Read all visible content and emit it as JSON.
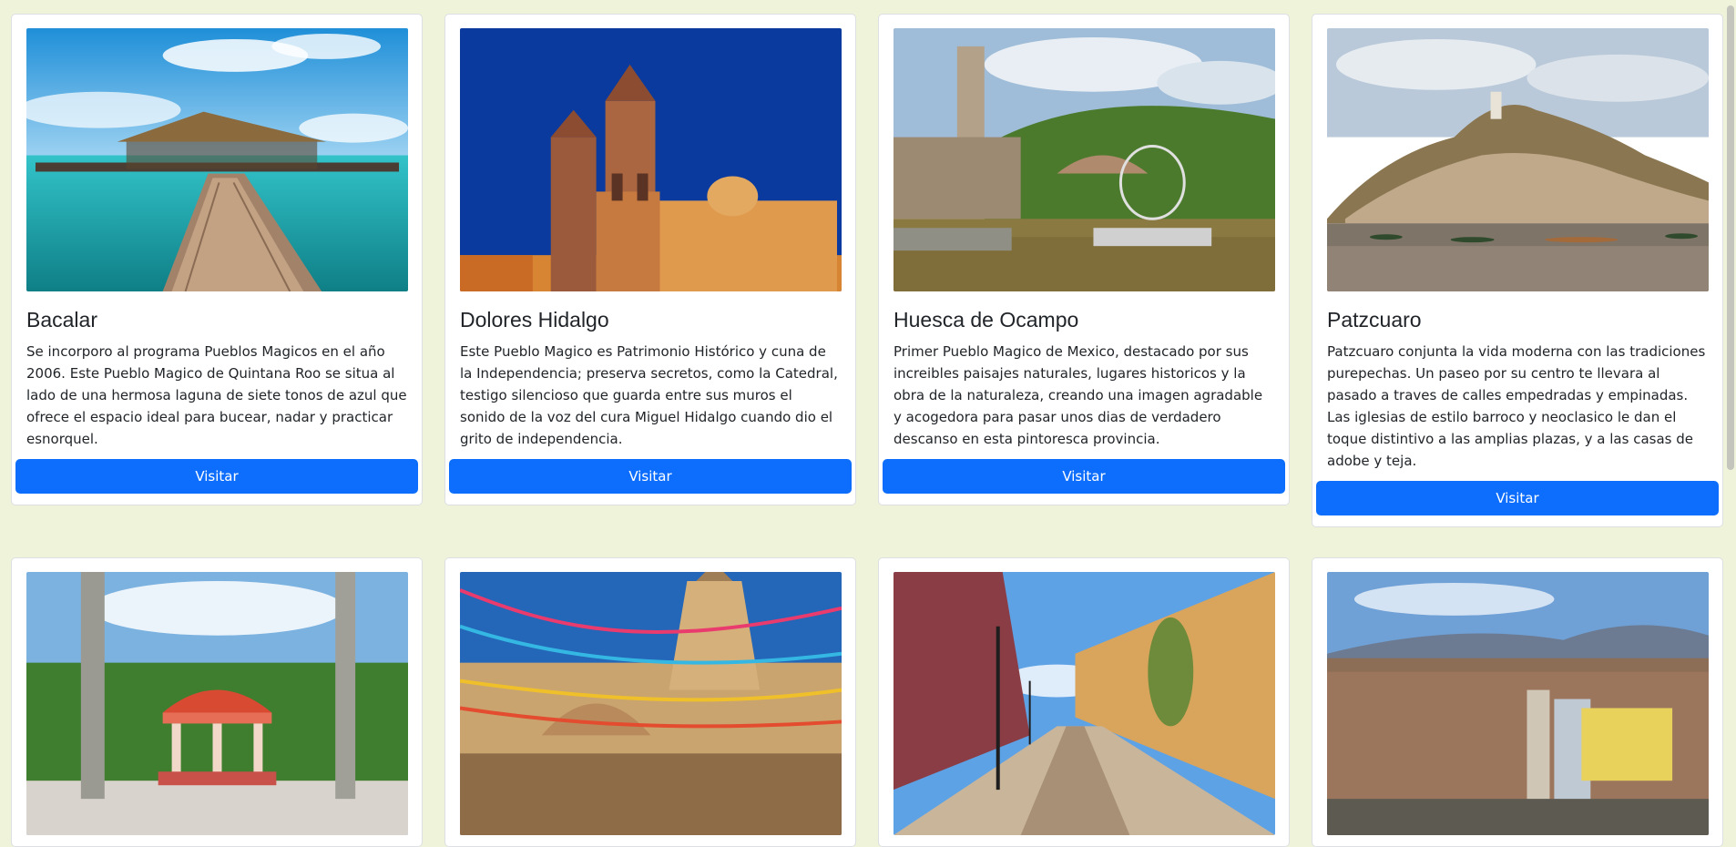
{
  "cards": [
    {
      "title": "Bacalar",
      "image_alt": "Bacalar",
      "text": "Se incorporo al programa Pueblos Magicos en el año 2006. Este Pueblo Magico de Quintana Roo se situa al lado de una hermosa laguna de siete tonos de azul que ofrece el espacio ideal para bucear, nadar y practicar esnorquel.",
      "button": "Visitar"
    },
    {
      "title": "Dolores Hidalgo",
      "image_alt": "Dolores Hidalgo",
      "text": "Este Pueblo Magico es Patrimonio Histórico y cuna de la Independencia; preserva secretos, como la Catedral, testigo silencioso que guarda entre sus muros el sonido de la voz del cura Miguel Hidalgo cuando dio el grito de independencia.",
      "button": "Visitar"
    },
    {
      "title": "Huesca de Ocampo",
      "image_alt": "Huesca de Ocampo",
      "text": "Primer Pueblo Magico de Mexico, destacado por sus increibles paisajes naturales, lugares historicos y la obra de la naturaleza, creando una imagen agradable y acogedora para pasar unos dias de verdadero descanso en esta pintoresca provincia.",
      "button": "Visitar"
    },
    {
      "title": "Patzcuaro",
      "image_alt": "Patzcuaro",
      "text": "Patzcuaro conjunta la vida moderna con las tradiciones purepechas. Un paseo por su centro te llevara al pasado a traves de calles empedradas y empinadas. Las iglesias de estilo barroco y neoclasico le dan el toque distintivo a las amplias plazas, y a las casas de adobe y teja.",
      "button": "Visitar"
    },
    {
      "title": "",
      "image_alt": "",
      "text": "",
      "button": ""
    },
    {
      "title": "",
      "image_alt": "",
      "text": "",
      "button": ""
    },
    {
      "title": "",
      "image_alt": "",
      "text": "",
      "button": ""
    },
    {
      "title": "",
      "image_alt": "",
      "text": "",
      "button": ""
    }
  ],
  "colors": {
    "page_background": "#eff3da",
    "button": "#0d6efd",
    "button_text": "#ffffff"
  }
}
